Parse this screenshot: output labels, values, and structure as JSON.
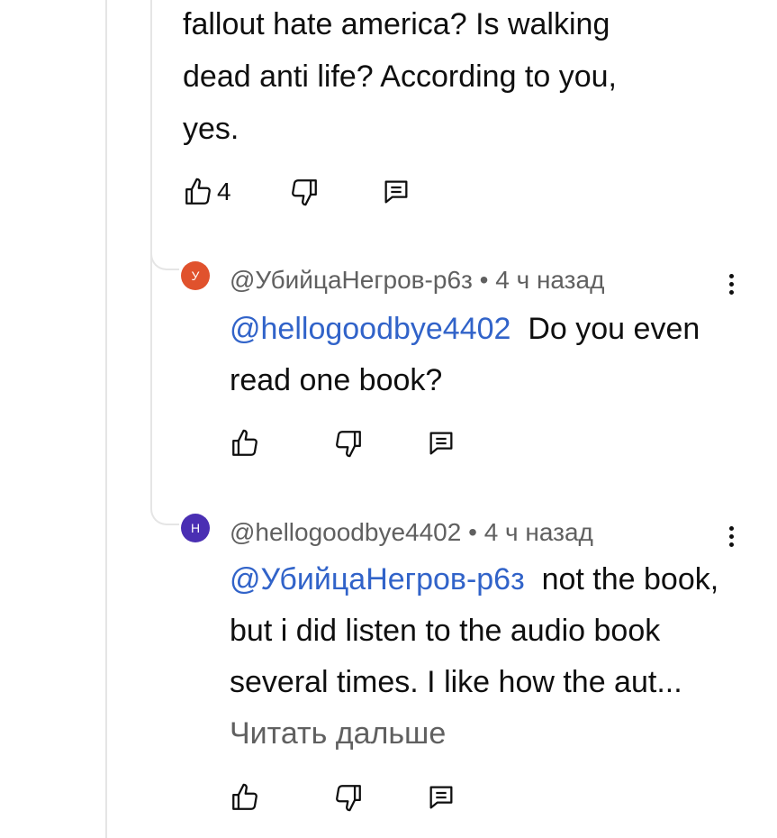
{
  "parent_comment": {
    "text": "fallout hate america? Is walking\ndead anti life? According to you,\nyes.",
    "like_count": "4"
  },
  "replies": [
    {
      "avatar_letter": "У",
      "avatar_color": "#e0522d",
      "author": "@УбийцаНегров-р6з",
      "separator": " • ",
      "time": "4 ч назад",
      "mention": "@hellogoodbye4402",
      "text": "Do you even read one book?",
      "read_more": ""
    },
    {
      "avatar_letter": "H",
      "avatar_color": "#4a2fb3",
      "author": "@hellogoodbye4402",
      "separator": " • ",
      "time": "4 ч назад",
      "mention": "@УбийцаНегров-р6з",
      "text": "not the book, but i did listen to the audio book several times. I like how the aut...",
      "read_more": "Читать дальше"
    }
  ],
  "icons": {
    "like": "thumb-up-icon",
    "dislike": "thumb-down-icon",
    "reply": "reply-comment-icon",
    "menu": "more-vert-icon"
  },
  "colors": {
    "mention": "#3163c9",
    "meta": "#606060",
    "thread_line": "#e5e5e5"
  }
}
